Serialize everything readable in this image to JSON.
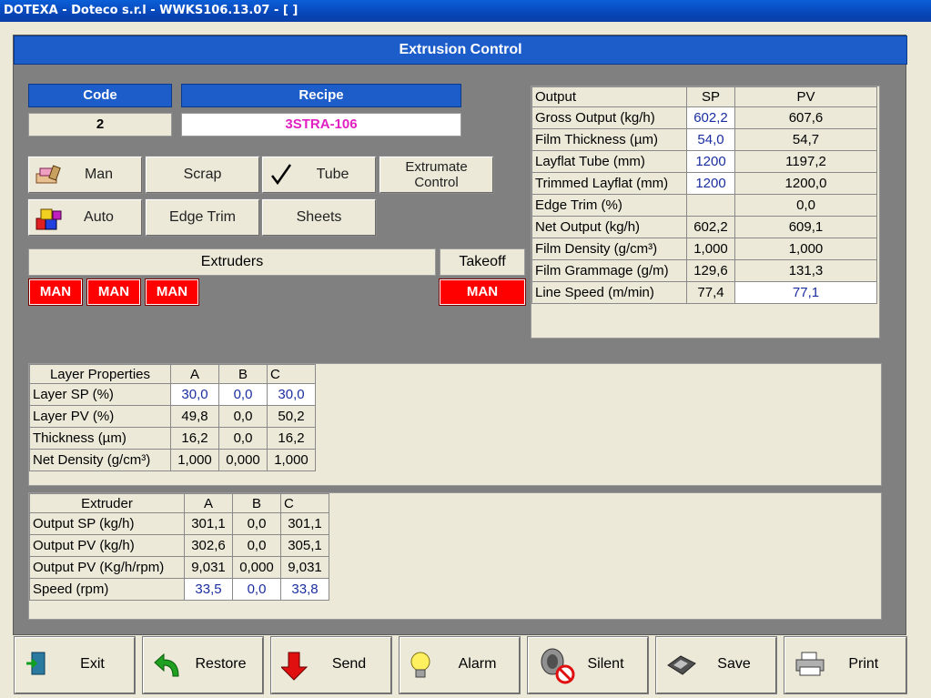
{
  "window": {
    "title": "DOTEXA - Doteco s.r.l - WWKS106.13.07 - [ ]"
  },
  "header": {
    "title": "Extrusion Control"
  },
  "code": {
    "label": "Code",
    "value": "2"
  },
  "recipe": {
    "label": "Recipe",
    "value": "3STRA-106"
  },
  "modes": {
    "man": "Man",
    "scrap": "Scrap",
    "tube": "Tube",
    "extrumate_line1": "Extrumate",
    "extrumate_line2": "Control",
    "auto": "Auto",
    "edge_trim": "Edge Trim",
    "sheets": "Sheets"
  },
  "extruders": {
    "label": "Extruders",
    "states": [
      "MAN",
      "MAN",
      "MAN"
    ]
  },
  "takeoff": {
    "label": "Takeoff",
    "state": "MAN"
  },
  "output_table": {
    "headers": [
      "Output",
      "SP",
      "PV"
    ],
    "rows": [
      {
        "label": "Gross Output (kg/h)",
        "sp": "602,2",
        "pv": "607,6"
      },
      {
        "label": "Film Thickness (µm)",
        "sp": "54,0",
        "pv": "54,7"
      },
      {
        "label": "Layflat Tube (mm)",
        "sp": "1200",
        "pv": "1197,2"
      },
      {
        "label": "Trimmed Layflat (mm)",
        "sp": "1200",
        "pv": "1200,0"
      },
      {
        "label": "Edge Trim (%)",
        "sp": "",
        "pv": "0,0"
      },
      {
        "label": "Net Output (kg/h)",
        "sp": "602,2",
        "pv": "609,1"
      },
      {
        "label": "Film Density (g/cm³)",
        "sp": "1,000",
        "pv": "1,000"
      },
      {
        "label": "Film Grammage (g/m)",
        "sp": "129,6",
        "pv": "131,3"
      },
      {
        "label": "Line Speed (m/min)",
        "sp": "77,4",
        "pv": "77,1"
      }
    ]
  },
  "layer_table": {
    "headers": [
      "Layer Properties",
      "A",
      "B",
      "C"
    ],
    "rows": [
      {
        "label": "Layer SP (%)",
        "a": "30,0",
        "b": "0,0",
        "c": "30,0"
      },
      {
        "label": "Layer PV (%)",
        "a": "49,8",
        "b": "0,0",
        "c": "50,2"
      },
      {
        "label": "Thickness (µm)",
        "a": "16,2",
        "b": "0,0",
        "c": "16,2"
      },
      {
        "label": "Net Density (g/cm³)",
        "a": "1,000",
        "b": "0,000",
        "c": "1,000"
      }
    ]
  },
  "extruder_table": {
    "headers": [
      "Extruder",
      "A",
      "B",
      "C"
    ],
    "rows": [
      {
        "label": "Output SP (kg/h)",
        "a": "301,1",
        "b": "0,0",
        "c": "301,1"
      },
      {
        "label": "Output PV (kg/h)",
        "a": "302,6",
        "b": "0,0",
        "c": "305,1"
      },
      {
        "label": "Output PV (Kg/h/rpm)",
        "a": "9,031",
        "b": "0,000",
        "c": "9,031"
      },
      {
        "label": "Speed (rpm)",
        "a": "33,5",
        "b": "0,0",
        "c": "33,8"
      }
    ]
  },
  "toolbar": {
    "exit": "Exit",
    "restore": "Restore",
    "send": "Send",
    "alarm": "Alarm",
    "silent": "Silent",
    "save": "Save",
    "print": "Print"
  }
}
